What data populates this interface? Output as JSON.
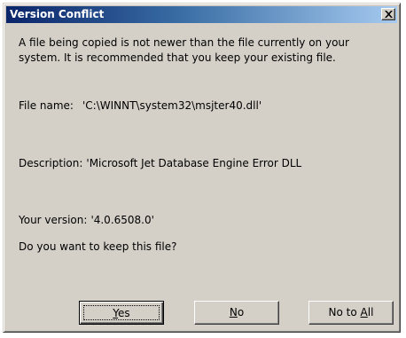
{
  "window": {
    "title": "Version Conflict",
    "close_icon": "close-icon"
  },
  "message": {
    "line1": "A file being copied is not newer than the file currently on your",
    "line2": "system. It is recommended that you keep your existing file."
  },
  "file_name": {
    "label": "File name:",
    "value": "'C:\\WINNT\\system32\\msjter40.dll'"
  },
  "description": {
    "label": "Description:",
    "value": "'Microsoft Jet Database Engine Error DLL"
  },
  "version": {
    "label": "Your version:",
    "value": "'4.0.6508.0'"
  },
  "question": "Do you want to keep this file?",
  "buttons": {
    "yes": {
      "pre": "",
      "accel": "Y",
      "post": "es"
    },
    "no": {
      "pre": "",
      "accel": "N",
      "post": "o"
    },
    "no_to_all": {
      "pre": "No to ",
      "accel": "A",
      "post": "ll"
    }
  }
}
